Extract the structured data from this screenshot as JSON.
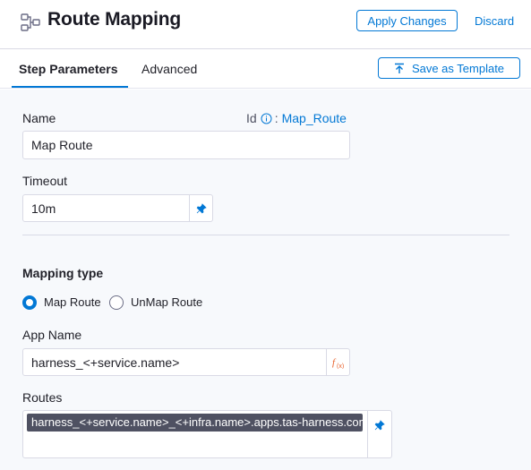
{
  "header": {
    "title": "Route Mapping",
    "apply_label": "Apply Changes",
    "discard_label": "Discard",
    "icon": "step-icon"
  },
  "tabs": [
    {
      "label": "Step Parameters",
      "active": true
    },
    {
      "label": "Advanced",
      "active": false
    }
  ],
  "save_template_label": "Save as Template",
  "form": {
    "name_label": "Name",
    "name_value": "Map Route",
    "id_label": "Id",
    "id_sep": ":",
    "id_value": "Map_Route",
    "timeout_label": "Timeout",
    "timeout_value": "10m",
    "mapping_type_label": "Mapping type",
    "mapping_options": [
      {
        "label": "Map Route",
        "checked": true
      },
      {
        "label": "UnMap Route",
        "checked": false
      }
    ],
    "app_name_label": "App Name",
    "app_name_value": "harness_<+service.name>",
    "routes_label": "Routes",
    "routes_value": "harness_<+service.name>_<+infra.name>.apps.tas-harness.com"
  },
  "colors": {
    "accent": "#0278d5",
    "expression_icon": "#e8612c",
    "tag_bg": "#4f5162"
  }
}
